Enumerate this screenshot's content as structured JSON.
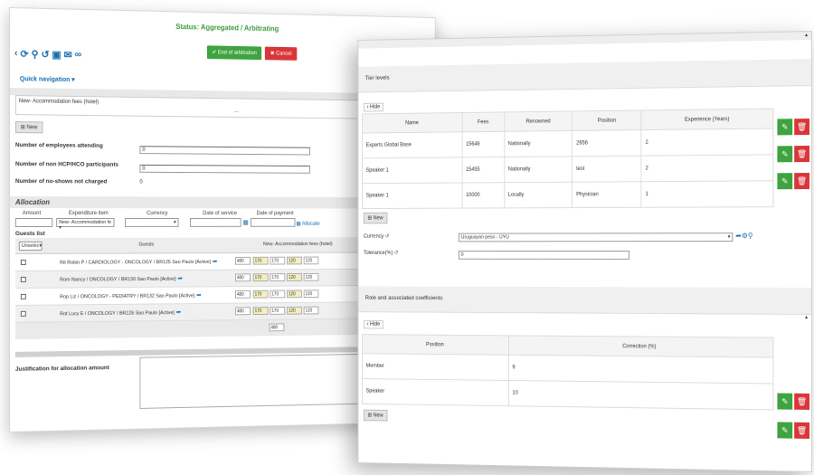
{
  "left": {
    "status": "Status: Aggregated / Arbitrating",
    "end_arbitration": "End of arbitration",
    "cancel": "Cancel",
    "close_caret": "^",
    "quick_navigation": "Quick navigation",
    "fees_label": "New- Accommodation fees (hotel)",
    "fees_dots": "...",
    "new_label": "New",
    "employees_label": "Number of employees attending",
    "employees_value": "0",
    "non_hcp_label": "Number of non HCP/HCO participants",
    "non_hcp_value": "0",
    "no_shows_label": "Number of no-shows not charged",
    "no_shows_value": "0",
    "allocation_title": "Allocation",
    "col_amount": "Amount",
    "col_expenditure": "Expenditure item",
    "col_currency": "Currency",
    "col_date_service": "Date of service",
    "col_date_payment": "Date of payment",
    "expenditure_value": "New- Accommodation fe",
    "allocate": "Allocate",
    "guests_list": "Guests list",
    "unselect": "Unselec",
    "guests_header": "Guests",
    "fees_header": "New- Accommodation fees (hotel)",
    "guests": [
      {
        "name": "Rit Robin P / CARDIOLOGY - ONCOLOGY / BR125 Sao Paulo [Active]",
        "fees": [
          "480",
          "170",
          "170",
          "120",
          "120"
        ]
      },
      {
        "name": "Rom Nancy / ONCOLOGY / BR130 Sao Paulo [Active]",
        "fees": [
          "480",
          "170",
          "170",
          "120",
          "120"
        ]
      },
      {
        "name": "Rop Liz / ONCOLOGY - PEDIATRY / BR132 Sao Paulo [Active]",
        "fees": [
          "480",
          "170",
          "170",
          "120",
          "120"
        ]
      },
      {
        "name": "Rot Lucy E / ONCOLOGY / BR126 Sao Paulo [Active]",
        "fees": [
          "480",
          "170",
          "170",
          "120",
          "120"
        ]
      }
    ],
    "total": "480",
    "justification_label": "Justification for allocation amount"
  },
  "right": {
    "tier_levels": "Tier levels",
    "hide": "Hide",
    "tier_headers": [
      "Name",
      "Fees",
      "Renowned",
      "Position",
      "Experience (Years)"
    ],
    "tiers": [
      {
        "name": "Experts Global Base",
        "fees": "15646",
        "renowned": "Nationally",
        "position": "2656",
        "experience": "2"
      },
      {
        "name": "Speaker 1",
        "fees": "15455",
        "renowned": "Nationally",
        "position": "test",
        "experience": "2"
      },
      {
        "name": "Speaker 1",
        "fees": "10000",
        "renowned": "Locally",
        "position": "Physician",
        "experience": "1"
      }
    ],
    "new_label": "New",
    "currency_label": "Currency",
    "currency_value": "Uruguayan peso - UYU",
    "tolerance_label": "Tolerance(%)",
    "tolerance_value": "0",
    "role_section": "Role and associated coefficients",
    "role_headers": [
      "Position",
      "Correction (%)"
    ],
    "roles": [
      {
        "position": "Member",
        "correction": "9"
      },
      {
        "position": "Speaker",
        "correction": "10"
      }
    ]
  },
  "colors": {
    "green": "#3fa33f",
    "red": "#d9363a",
    "link": "#1a6fb0"
  }
}
